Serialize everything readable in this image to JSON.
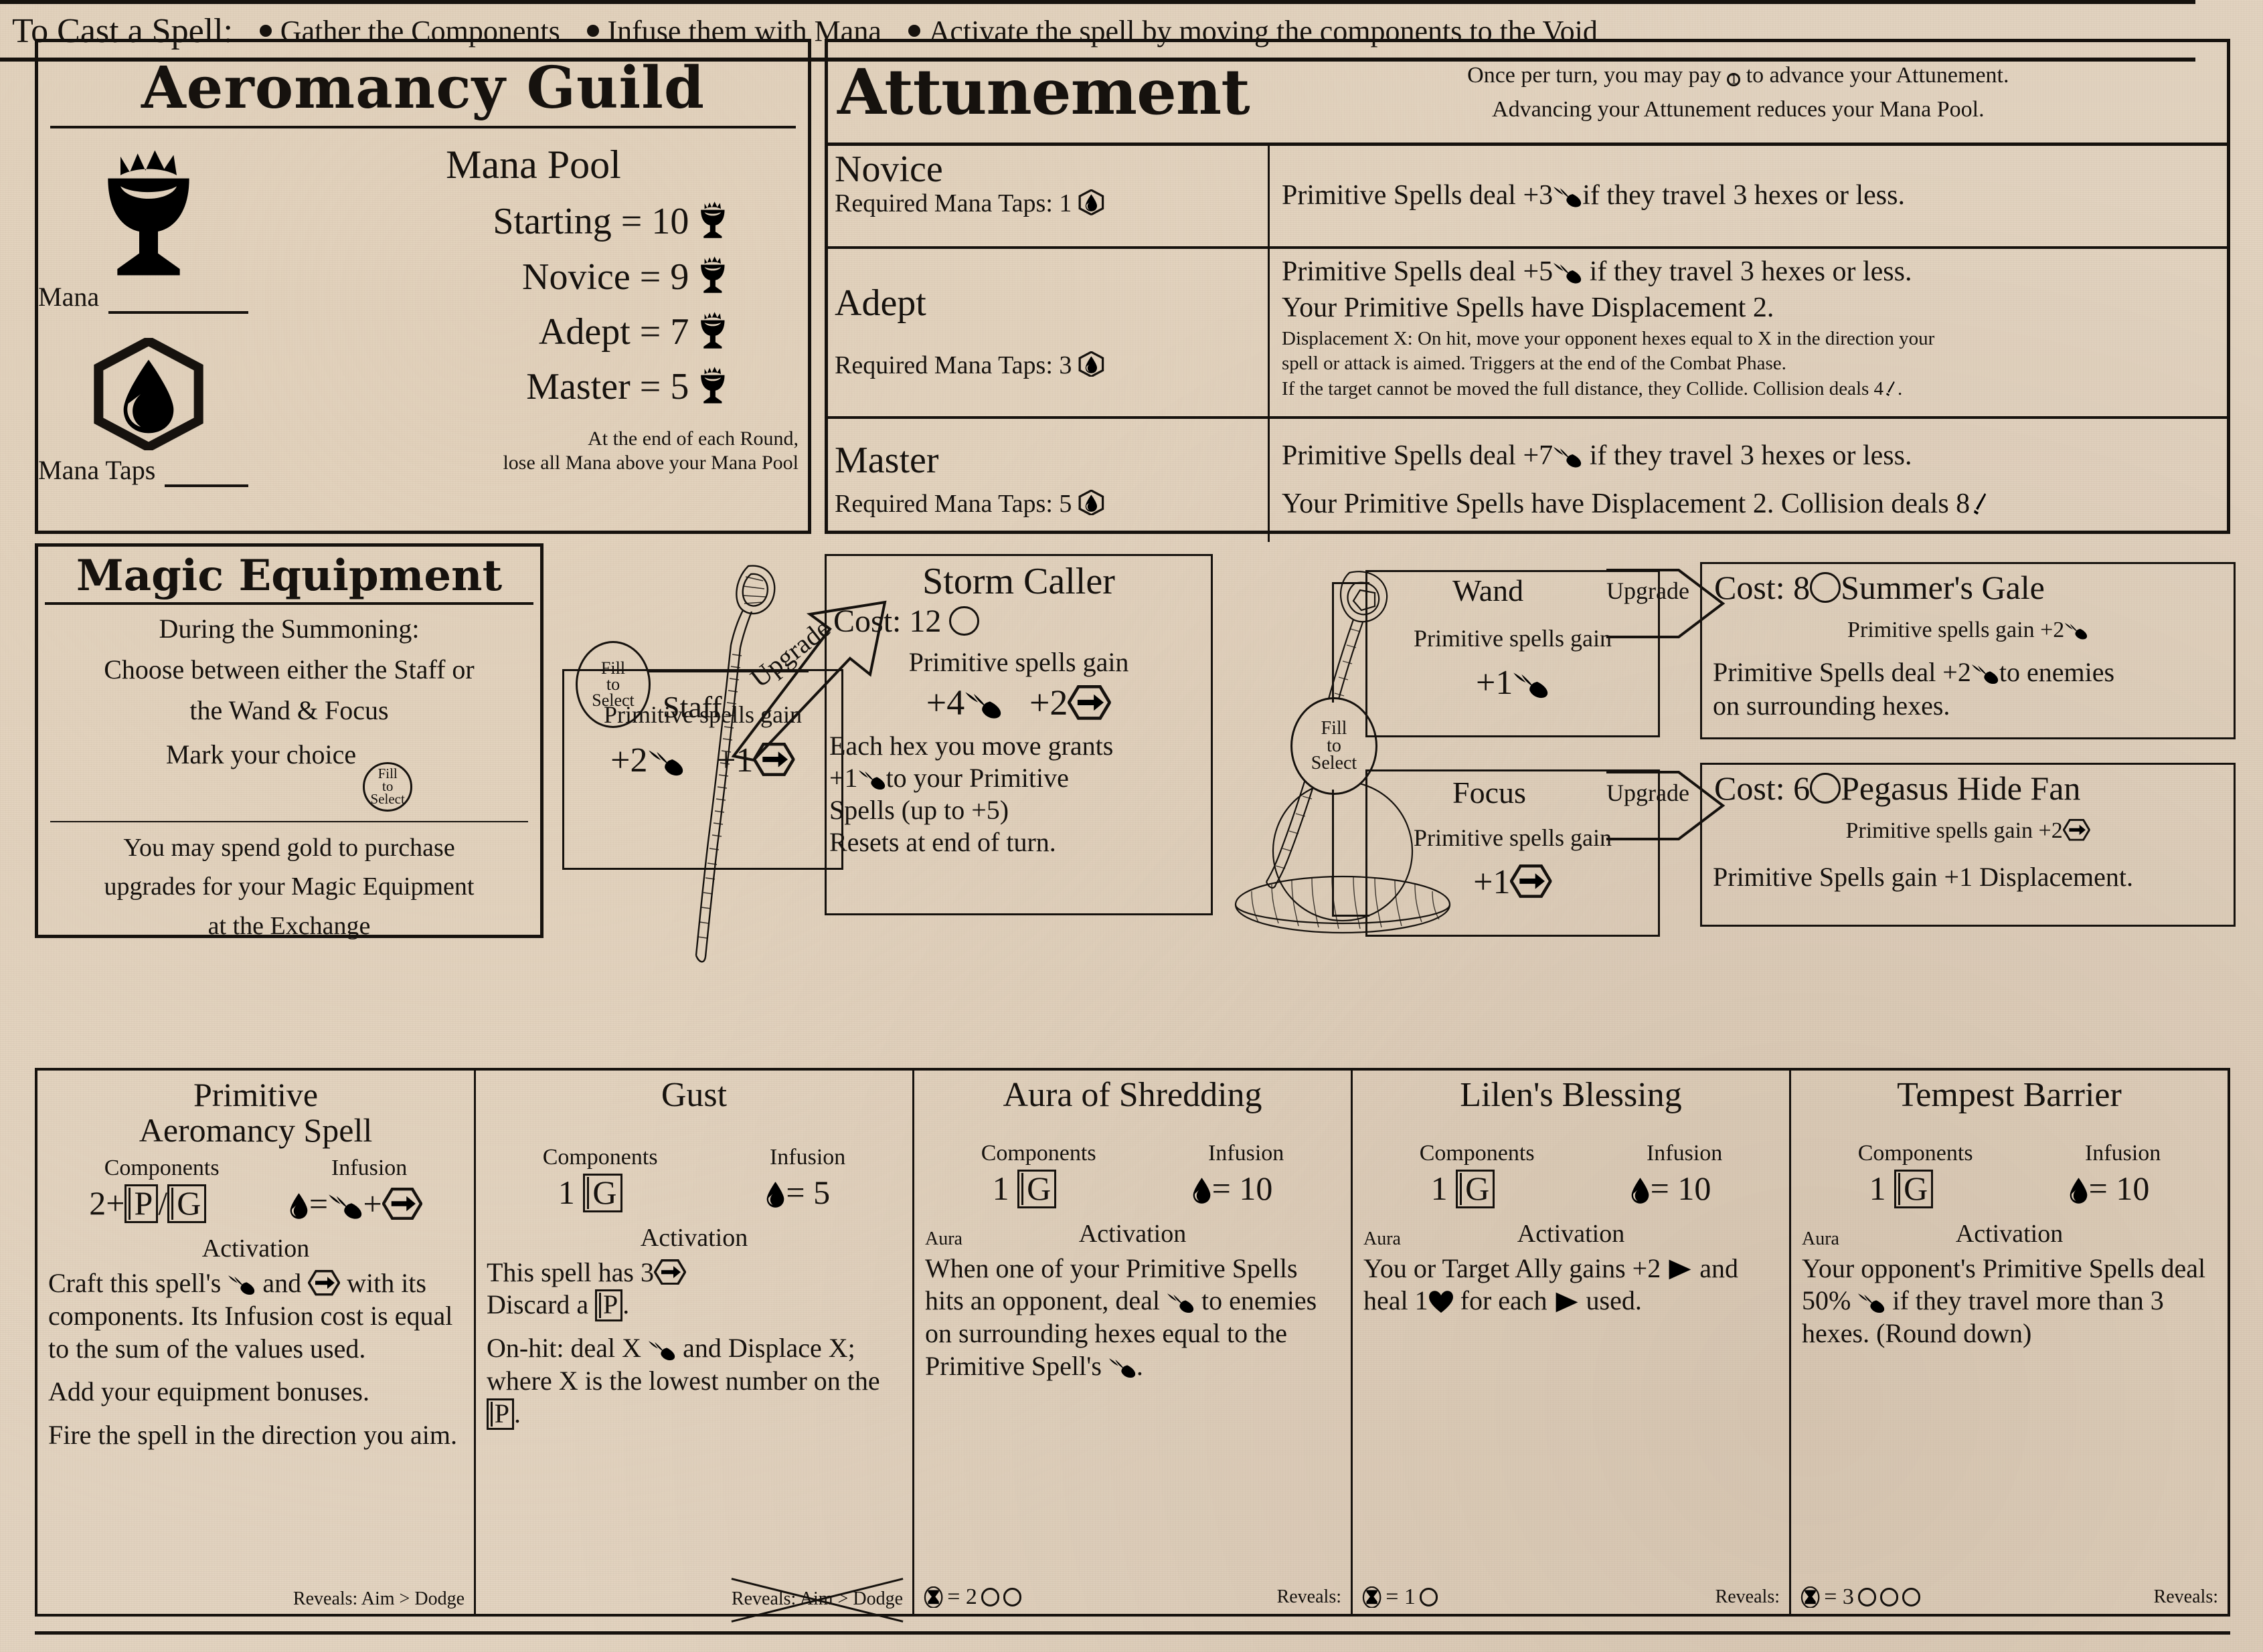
{
  "guild": {
    "title": "Aeromancy Guild",
    "mana_label": "Mana",
    "mana_taps_label": "Mana Taps",
    "pool_title": "Mana Pool",
    "pool_rows": [
      {
        "label": "Starting =",
        "value": "10"
      },
      {
        "label": "Novice =",
        "value": "9"
      },
      {
        "label": "Adept =",
        "value": "7"
      },
      {
        "label": "Master =",
        "value": "5"
      }
    ],
    "pool_note_1": "At the end of each Round,",
    "pool_note_2": "lose all Mana above your Mana Pool"
  },
  "attunement": {
    "title": "Attunement",
    "note_1_a": "Once per turn, you may pay",
    "note_1_b": "to advance your Attunement.",
    "note_2": "Advancing your Attunement reduces your Mana Pool.",
    "one_symbol": "1",
    "rows": [
      {
        "name": "Novice",
        "taps_label": "Required Mana Taps:",
        "taps": "1",
        "lines": [
          {
            "a": "Primitive Spells deal +3",
            "b": "if they travel 3 hexes or less.",
            "size": "big"
          }
        ]
      },
      {
        "name": "Adept",
        "taps_label": "Required Mana Taps:",
        "taps": "3",
        "lines": [
          {
            "a": "Primitive Spells deal +5",
            "b": "if they travel 3 hexes or less.",
            "size": "big"
          },
          {
            "a": "Your Primitive Spells have Displacement 2.",
            "b": "",
            "size": "big"
          },
          {
            "a": "Displacement X: On hit, move your opponent hexes equal to X in the direction your",
            "b": "",
            "size": "small"
          },
          {
            "a": "spell or attack is aimed. Triggers at the end of the Combat Phase.",
            "b": "",
            "size": "small"
          },
          {
            "a": "If the target cannot be moved the full distance, they Collide. Collision deals 4",
            "b": "",
            "size": "small-sword"
          }
        ]
      },
      {
        "name": "Master",
        "taps_label": "Required Mana Taps:",
        "taps": "5",
        "lines": [
          {
            "a": "Primitive Spells deal +7",
            "b": "if they travel 3 hexes or less.",
            "size": "big"
          },
          {
            "a": "Your Primitive Spells have Displacement 2. Collision deals 8",
            "b": "",
            "size": "big-sword"
          }
        ]
      }
    ]
  },
  "equipment": {
    "title": "Magic Equipment",
    "line_1": "During the Summoning:",
    "line_2": "Choose between either the Staff or",
    "line_3": "the Wand & Focus",
    "line_4": "Mark your choice",
    "line_5": "You may spend gold to purchase",
    "line_6": "upgrades for your Magic Equipment",
    "line_7": "at the Exchange",
    "fill_to_select": [
      "Fill",
      "to",
      "Select"
    ]
  },
  "staff": {
    "name": "Staff",
    "upgrade_label": "Upgrade",
    "gain_label": "Primitive spells gain",
    "bonus_damage": "+2",
    "bonus_displace": "+1"
  },
  "storm_caller": {
    "name": "Storm Caller",
    "cost_label": "Cost: 12",
    "gain_label": "Primitive spells gain",
    "bonus_damage": "+4",
    "bonus_displace": "+2",
    "line_1": "Each hex you move grants",
    "line_2_a": "+1",
    "line_2_b": "to your Primitive",
    "line_3": "Spells (up to +5)",
    "line_4": "Resets at end of turn."
  },
  "wand": {
    "name": "Wand",
    "upgrade_label": "Upgrade",
    "gain_label": "Primitive spells gain",
    "bonus_damage": "+1"
  },
  "focus": {
    "name": "Focus",
    "upgrade_label": "Upgrade",
    "gain_label": "Primitive spells gain",
    "bonus_displace": "+1"
  },
  "summers_gale": {
    "cost_label": "Cost: 8",
    "name": "Summer's Gale",
    "line_1_a": "Primitive spells gain",
    "line_1_b": "+2",
    "line_2_a": "Primitive Spells deal +2",
    "line_2_b": "to enemies",
    "line_3": "on surrounding hexes."
  },
  "pegasus_hide_fan": {
    "cost_label": "Cost: 6",
    "name": "Pegasus Hide Fan",
    "line_1_a": "Primitive spells gain",
    "line_1_b": "+2",
    "line_2": "Primitive Spells gain +1 Displacement."
  },
  "cast_banner": {
    "lead": "To Cast a Spell:",
    "steps": [
      "Gather the Components",
      "Infuse them with Mana",
      "Activate the spell by moving the components to the Void"
    ]
  },
  "spell_cards": [
    {
      "title_line_1": "Primitive",
      "title_line_2": "Aeromancy Spell",
      "components_label": "Components",
      "infusion_label": "Infusion",
      "components_value": "2+",
      "components_cards": [
        "P",
        "G"
      ],
      "infusion_value": "",
      "infusion_mode": "formula",
      "activation_label": "Activation",
      "aura_label": "",
      "body": [
        {
          "t": "Craft this spell's",
          "icon1": "comet",
          "t2": "and",
          "icon2": "hexarrow",
          "t3": "with its components. Its Infusion cost is equal to the sum of the values used."
        },
        {
          "t": "Add your equipment bonuses."
        },
        {
          "t": "Fire the spell in the direction you aim."
        }
      ],
      "footer_left": "",
      "footer_right": "Reveals: Aim > Dodge",
      "footer_right_strike": false
    },
    {
      "title_line_1": "Gust",
      "title_line_2": "",
      "components_label": "Components",
      "infusion_label": "Infusion",
      "components_value": "1",
      "components_cards": [
        "G"
      ],
      "infusion_value": "= 5",
      "infusion_mode": "value",
      "activation_label": "Activation",
      "aura_label": "",
      "body": [
        {
          "t": "This spell has 3",
          "icon1": "hexarrow",
          "t2": "Discard a",
          "icon2": "cardP",
          "t3": "."
        },
        {
          "t": "On-hit: deal X",
          "icon1": "comet",
          "t2": "and Displace X; where X is the lowest number on the",
          "icon2": "cardP",
          "t3": "."
        }
      ],
      "footer_left": "",
      "footer_right": "Reveals: Aim > Dodge",
      "footer_right_strike": true
    },
    {
      "title_line_1": "Aura of Shredding",
      "title_line_2": "",
      "components_label": "Components",
      "infusion_label": "Infusion",
      "components_value": "1",
      "components_cards": [
        "G"
      ],
      "infusion_value": "= 10",
      "infusion_mode": "value",
      "activation_label": "Activation",
      "aura_label": "Aura",
      "body": [
        {
          "t": "When one of your Primitive Spells hits an opponent, deal",
          "icon1": "comet",
          "t2": "to enemies on surrounding hexes equal to the Primitive Spell's",
          "icon2": "comet",
          "t3": "."
        }
      ],
      "footer_left": "= 2",
      "footer_left_circles": 2,
      "footer_right": "Reveals:",
      "footer_right_strike": false
    },
    {
      "title_line_1": "Lilen's Blessing",
      "title_line_2": "",
      "components_label": "Components",
      "infusion_label": "Infusion",
      "components_value": "1",
      "components_cards": [
        "G"
      ],
      "infusion_value": "= 10",
      "infusion_mode": "value",
      "activation_label": "Activation",
      "aura_label": "Aura",
      "body": [
        {
          "t": "You or Target Ally gains +2",
          "icon1": "tri",
          "t2": "and heal 1",
          "icon2": "heart",
          "t3": "for each",
          "icon3": "tri",
          "t4": "used."
        }
      ],
      "footer_left": "= 1",
      "footer_left_circles": 1,
      "footer_right": "Reveals:",
      "footer_right_strike": false
    },
    {
      "title_line_1": "Tempest Barrier",
      "title_line_2": "",
      "components_label": "Components",
      "infusion_label": "Infusion",
      "components_value": "1",
      "components_cards": [
        "G"
      ],
      "infusion_value": "= 10",
      "infusion_mode": "value",
      "activation_label": "Activation",
      "aura_label": "Aura",
      "body": [
        {
          "t": "Your opponent's Primitive Spells deal 50%",
          "icon1": "comet",
          "t2": "if they travel more than 3 hexes. (Round down)"
        }
      ],
      "footer_left": "= 3",
      "footer_left_circles": 3,
      "footer_right": "Reveals:",
      "footer_right_strike": false
    }
  ],
  "colors": {
    "paper": "#e2d3c0",
    "ink": "#16120e"
  }
}
